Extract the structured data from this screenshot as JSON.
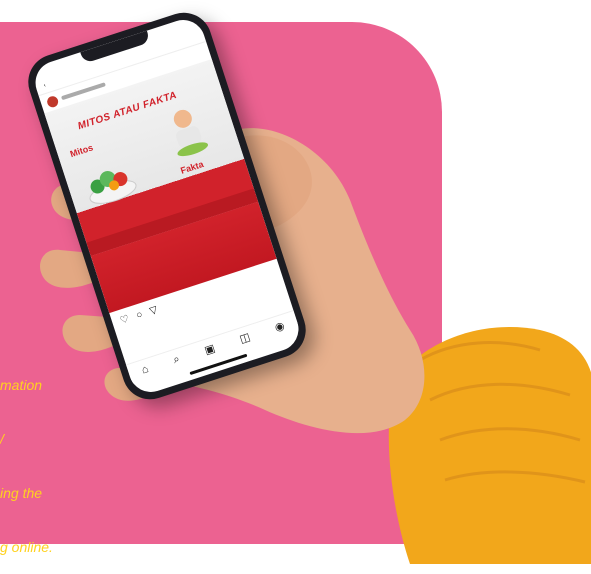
{
  "caption": {
    "line1": "mation",
    "line2": "/",
    "line3": "ing the",
    "line4": "g online."
  },
  "phone": {
    "post_title": "MITOS ATAU FAKTA",
    "myth_label": "Mitos",
    "fact_label": "Fakta"
  },
  "colors": {
    "panel": "#ec6291",
    "caption": "#ffd21f",
    "accent_red": "#d1222b",
    "sleeve": "#f2a71b"
  }
}
